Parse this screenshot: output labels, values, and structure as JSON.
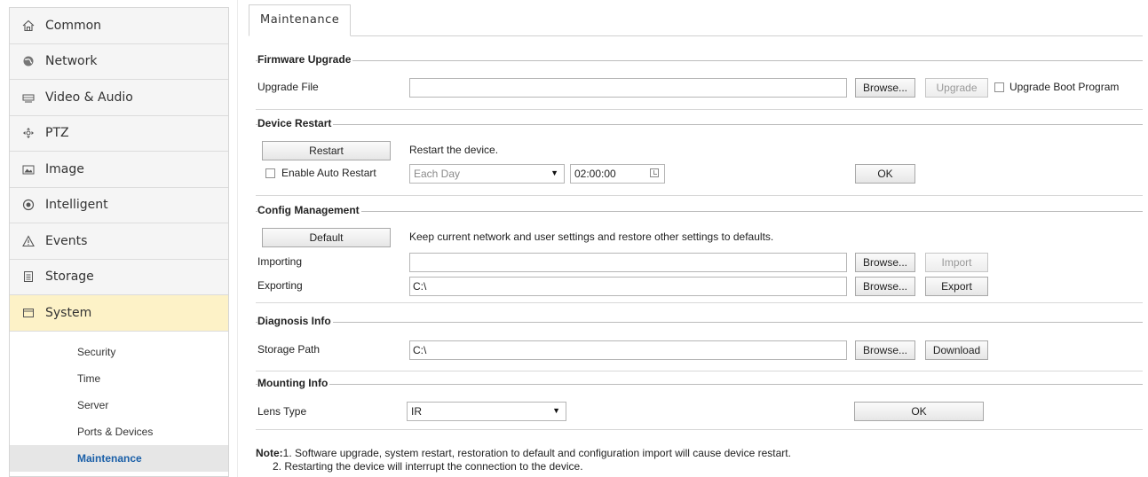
{
  "sidebar": {
    "items": [
      {
        "label": "Common",
        "icon": "home-icon"
      },
      {
        "label": "Network",
        "icon": "globe-icon"
      },
      {
        "label": "Video & Audio",
        "icon": "video-icon"
      },
      {
        "label": "PTZ",
        "icon": "ptz-icon"
      },
      {
        "label": "Image",
        "icon": "image-icon"
      },
      {
        "label": "Intelligent",
        "icon": "intelligent-icon"
      },
      {
        "label": "Events",
        "icon": "warning-icon"
      },
      {
        "label": "Storage",
        "icon": "storage-icon"
      },
      {
        "label": "System",
        "icon": "system-icon"
      }
    ],
    "sub_items": [
      "Security",
      "Time",
      "Server",
      "Ports & Devices",
      "Maintenance"
    ],
    "active_sub": "Maintenance"
  },
  "tab": {
    "label": "Maintenance"
  },
  "firmware": {
    "title": "Firmware Upgrade",
    "file_label": "Upgrade File",
    "file_value": "",
    "browse": "Browse...",
    "upgrade": "Upgrade",
    "boot_label": "Upgrade Boot Program"
  },
  "restart": {
    "title": "Device Restart",
    "restart_btn": "Restart",
    "restart_desc": "Restart the device.",
    "auto_label": "Enable Auto Restart",
    "frequency": "Each Day",
    "time": "02:00:00",
    "ok": "OK"
  },
  "config": {
    "title": "Config Management",
    "default_btn": "Default",
    "default_desc": "Keep current network and user settings and restore other settings to defaults.",
    "import_label": "Importing",
    "import_value": "",
    "import_browse": "Browse...",
    "import_btn": "Import",
    "export_label": "Exporting",
    "export_value": "C:\\",
    "export_browse": "Browse...",
    "export_btn": "Export"
  },
  "diagnosis": {
    "title": "Diagnosis Info",
    "path_label": "Storage Path",
    "path_value": "C:\\",
    "browse": "Browse...",
    "download": "Download"
  },
  "mounting": {
    "title": "Mounting Info",
    "lens_label": "Lens Type",
    "lens_value": "IR",
    "ok": "OK"
  },
  "note": {
    "prefix": "Note:",
    "line1": "1. Software upgrade, system restart, restoration to default and configuration import will cause device restart.",
    "line2": "2. Restarting the device will interrupt the connection to the device."
  },
  "colors": {
    "active_menu_bg": "#fdf2c7",
    "active_sub_text": "#1a5fa8"
  }
}
